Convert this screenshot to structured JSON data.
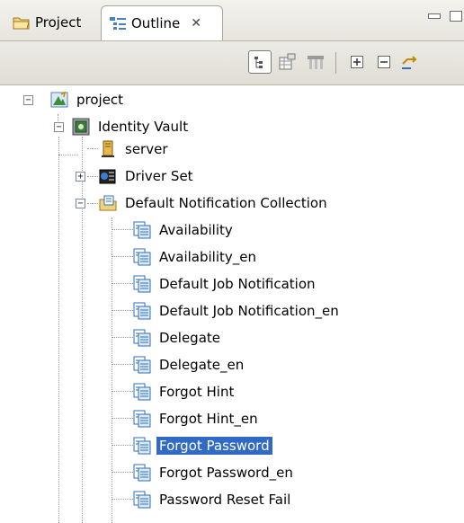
{
  "tabs": {
    "project": "Project",
    "outline": "Outline",
    "close_glyph": "✕"
  },
  "toolbar": {
    "buttons": [
      "tree-view-icon",
      "table-view-icon",
      "columns-view-icon",
      "expand-all-icon",
      "collapse-all-icon",
      "sync-icon"
    ]
  },
  "tree": {
    "root": "project",
    "vault": "Identity Vault",
    "server": "server",
    "driver_set": "Driver Set",
    "collection": "Default Notification Collection",
    "items": [
      "Availability",
      "Availability_en",
      "Default Job Notification",
      "Default Job Notification_en",
      "Delegate",
      "Delegate_en",
      "Forgot Hint",
      "Forgot Hint_en",
      "Forgot Password",
      "Forgot Password_en",
      "Password Reset Fail"
    ],
    "selected": "Forgot Password"
  },
  "colors": {
    "selection": "#316ac5",
    "accent": "#2f6fb5"
  }
}
